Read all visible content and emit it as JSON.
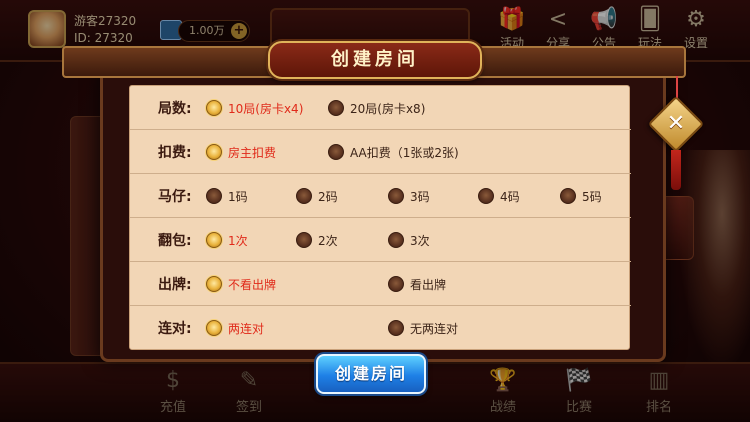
{
  "player": {
    "name": "游客27320",
    "id_text": "ID: 27320",
    "coins": "1.00万",
    "coins_add": "+"
  },
  "top_menu": [
    {
      "label": "活动",
      "icon": "gift-icon"
    },
    {
      "label": "分享",
      "icon": "share-icon"
    },
    {
      "label": "公告",
      "icon": "megaphone-icon"
    },
    {
      "label": "玩法",
      "icon": "cards-icon"
    },
    {
      "label": "设置",
      "icon": "gear-icon"
    }
  ],
  "bottom_menu": [
    {
      "label": "充值",
      "icon": "money-bag-icon"
    },
    {
      "label": "签到",
      "icon": "sign-in-icon"
    },
    {
      "label": "战绩",
      "icon": "trophy-icon"
    },
    {
      "label": "比赛",
      "icon": "race-flags-icon"
    },
    {
      "label": "排名",
      "icon": "podium-icon"
    }
  ],
  "dialog": {
    "title": "创建房间",
    "close": "✕",
    "create_button": "创建房间",
    "rows": [
      {
        "label": "局数:",
        "options": [
          {
            "text": "10局(房卡x4)",
            "selected": true
          },
          {
            "text": "20局(房卡x8)",
            "selected": false
          }
        ]
      },
      {
        "label": "扣费:",
        "options": [
          {
            "text": "房主扣费",
            "selected": true
          },
          {
            "text": "AA扣费（1张或2张)",
            "selected": false
          }
        ]
      },
      {
        "label": "马仔:",
        "options": [
          {
            "text": "1码",
            "selected": false
          },
          {
            "text": "2码",
            "selected": false
          },
          {
            "text": "3码",
            "selected": false
          },
          {
            "text": "4码",
            "selected": false
          },
          {
            "text": "5码",
            "selected": false
          }
        ]
      },
      {
        "label": "翻包:",
        "options": [
          {
            "text": "1次",
            "selected": true
          },
          {
            "text": "2次",
            "selected": false
          },
          {
            "text": "3次",
            "selected": false
          }
        ]
      },
      {
        "label": "出牌:",
        "options": [
          {
            "text": "不看出牌",
            "selected": true
          },
          {
            "text": "看出牌",
            "selected": false
          }
        ]
      },
      {
        "label": "连对:",
        "options": [
          {
            "text": "两连对",
            "selected": true
          },
          {
            "text": "无两连对",
            "selected": false
          }
        ]
      }
    ]
  },
  "colors": {
    "selected_text": "#e02a1a",
    "panel_bg": "#f2d6b6",
    "button_blue": "#1e80e6"
  }
}
